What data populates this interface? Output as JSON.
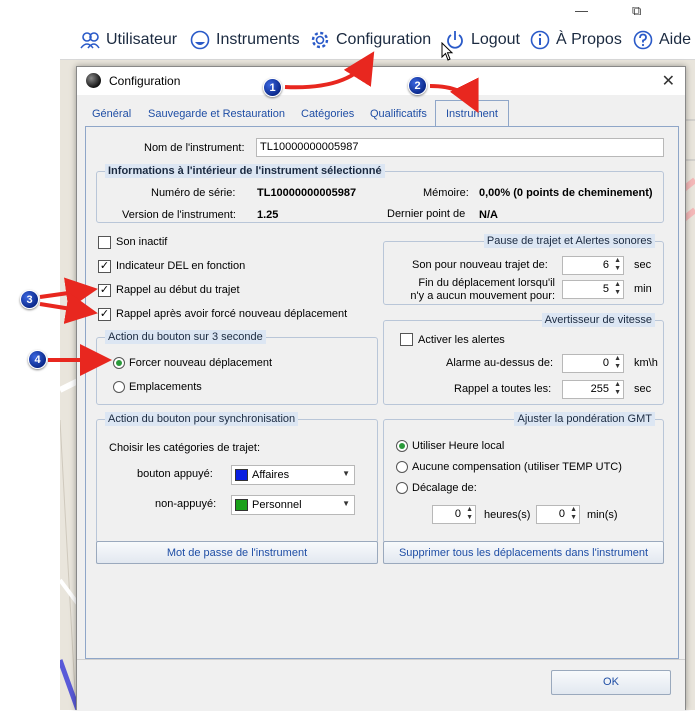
{
  "menubar": {
    "items": [
      {
        "label": "Utilisateur",
        "icon": "users-icon"
      },
      {
        "label": "Instruments",
        "icon": "instrument-icon"
      },
      {
        "label": "Configuration",
        "icon": "gear-icon"
      },
      {
        "label": "Logout",
        "icon": "power-icon"
      },
      {
        "label": "À Propos",
        "icon": "info-icon"
      },
      {
        "label": "Aide",
        "icon": "help-icon"
      }
    ]
  },
  "dialog": {
    "title": "Configuration",
    "tabs": [
      "Général",
      "Sauvegarde et Restauration",
      "Catégories",
      "Qualificatifs",
      "Instrument"
    ],
    "active_tab": "Instrument",
    "instrument_name_label": "Nom de l'instrument:",
    "instrument_name_value": "TL10000000005987",
    "info": {
      "title": "Informations à l'intérieur de l'instrument sélectionné",
      "serial_label": "Numéro de série:",
      "serial_value": "TL10000000005987",
      "version_label": "Version de l'instrument:",
      "version_value": "1.25",
      "memory_label": "Mémoire:",
      "memory_value": "0,00% (0 points de cheminement)",
      "lastpoint_label": "Dernier point de",
      "lastpoint_value": "N/A"
    },
    "checkboxes": [
      {
        "label": "Son inactif",
        "checked": false
      },
      {
        "label": "Indicateur DEL en fonction",
        "checked": true
      },
      {
        "label": "Rappel au début du trajet",
        "checked": true
      },
      {
        "label": "Rappel après avoir forcé nouveau déplacement",
        "checked": true
      }
    ],
    "pause": {
      "title": "Pause de trajet et Alertes sonores",
      "son_label": "Son pour nouveau trajet de:",
      "son_value": "6",
      "son_unit": "sec",
      "fin_label_1": "Fin du déplacement lorsqu'il",
      "fin_label_2": "n'y a aucun mouvement pour:",
      "fin_value": "5",
      "fin_unit": "min"
    },
    "button3": {
      "title": "Action du bouton sur 3 seconde",
      "opt1": "Forcer nouveau déplacement",
      "opt2": "Emplacements"
    },
    "speed": {
      "title": "Avertisseur de vitesse",
      "activate_label": "Activer les alertes",
      "alarm_label": "Alarme au-dessus de:",
      "alarm_value": "0",
      "alarm_unit": "km\\h",
      "reminder_label": "Rappel a toutes les:",
      "reminder_value": "255",
      "reminder_unit": "sec"
    },
    "sync": {
      "title": "Action du bouton pour synchronisation",
      "choose_label": "Choisir les catégories de trajet:",
      "pressed_label": "bouton appuyé:",
      "pressed_value": "Affaires",
      "pressed_color": "#0a1fe0",
      "unpressed_label": "non-appuyé:",
      "unpressed_value": "Personnel",
      "unpressed_color": "#1aa01a"
    },
    "gmt": {
      "title": "Ajuster la pondération GMT",
      "opt1": "Utiliser Heure local",
      "opt2": "Aucune compensation (utiliser TEMP UTC)",
      "opt3": "Décalage de:",
      "hours_value": "0",
      "hours_unit": "heures(s)",
      "min_value": "0",
      "min_unit": "min(s)"
    },
    "password_button": "Mot de passe de l'instrument",
    "delete_button": "Supprimer tous les déplacements dans l'instrument",
    "ok_button": "OK"
  },
  "annotations": {
    "badges": [
      "1",
      "2",
      "3",
      "4"
    ],
    "arrow_color": "#e8271f"
  }
}
